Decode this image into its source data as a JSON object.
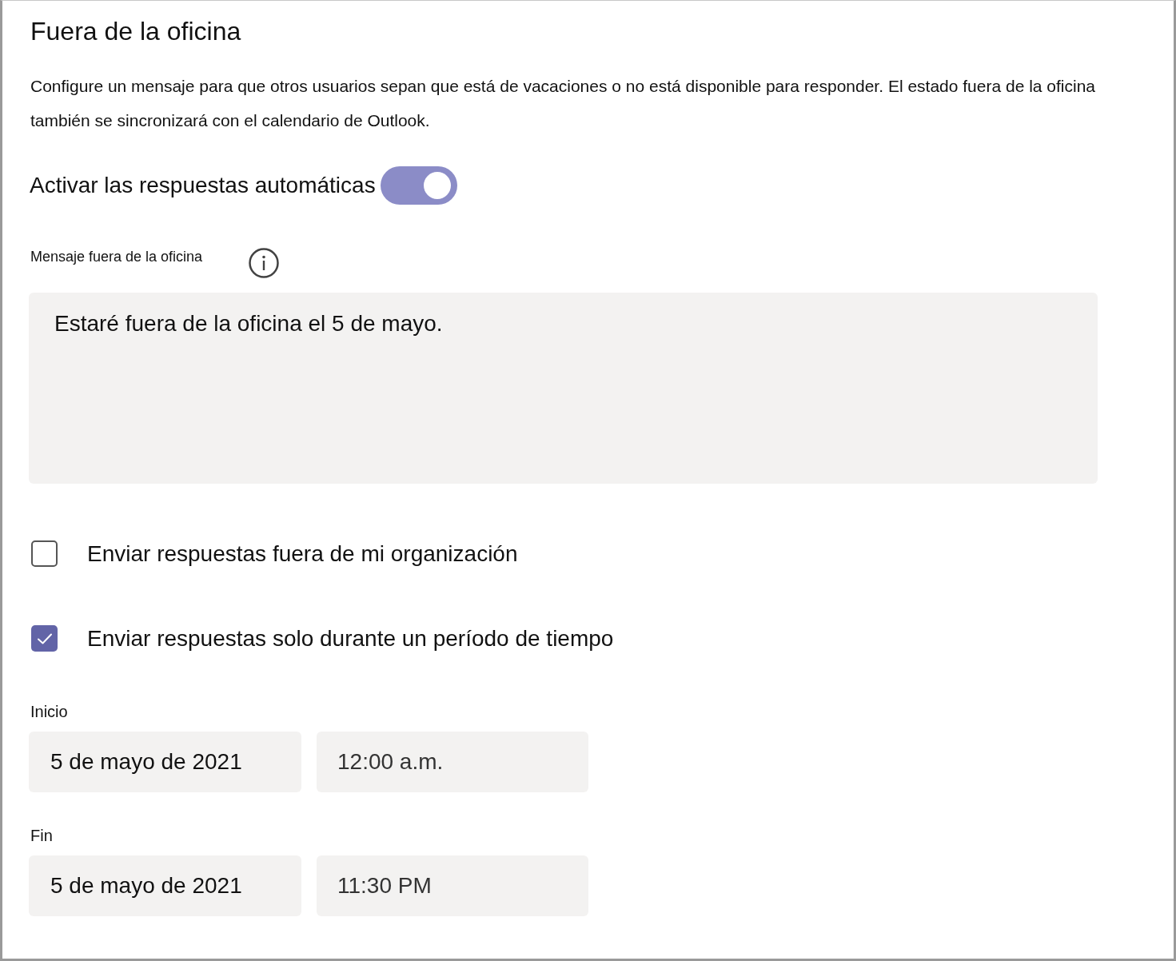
{
  "title": "Fuera de la oficina",
  "description": "Configure un mensaje para que otros usuarios sepan que está de vacaciones o no está disponible para responder. El estado fuera de la oficina también se sincronizará con el calendario de Outlook.",
  "auto_reply": {
    "label": "Activar las respuestas automáticas",
    "on": true
  },
  "message": {
    "label": "Mensaje fuera de la oficina",
    "value": "Estaré fuera de la oficina el 5 de mayo."
  },
  "options": [
    {
      "label": "Enviar respuestas fuera de mi organización",
      "checked": false
    },
    {
      "label": "Enviar respuestas solo durante un período de tiempo",
      "checked": true
    }
  ],
  "schedule": [
    {
      "label": "Inicio",
      "date": "5 de mayo de 2021",
      "time": "12:00 a.m."
    },
    {
      "label": "Fin",
      "date": "5 de mayo de 2021",
      "time": "11:30 PM"
    }
  ]
}
